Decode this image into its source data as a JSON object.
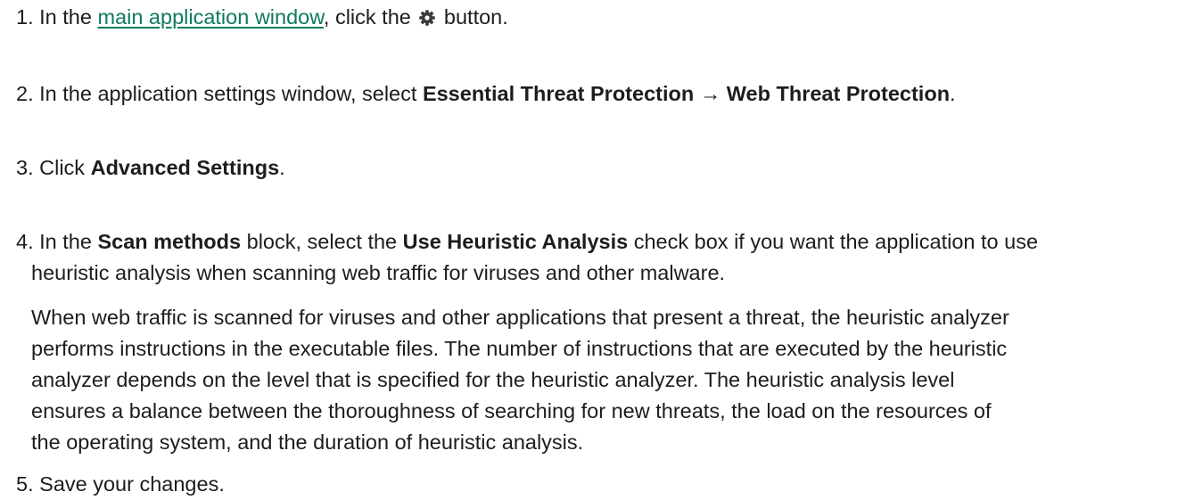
{
  "steps": [
    {
      "number": "1.",
      "pre": "In the ",
      "link": "main application window",
      "mid": ", click the ",
      "icon": "gear-icon",
      "post": " button."
    },
    {
      "number": "2.",
      "pre": "In the application settings window, select ",
      "bold1": "Essential Threat Protection",
      "arrow": " → ",
      "bold2": "Web Threat Protection",
      "post": "."
    },
    {
      "number": "3.",
      "pre": "Click ",
      "bold1": "Advanced Settings",
      "post": "."
    },
    {
      "number": "4.",
      "pre": "In the ",
      "bold1": "Scan methods",
      "mid": " block, select the ",
      "bold2": "Use Heuristic Analysis",
      "post_line1": " check box if you want the application to use",
      "post_line2": "heuristic analysis when scanning web traffic for viruses and other malware.",
      "note_lines": [
        "When web traffic is scanned for viruses and other applications that present a threat, the heuristic analyzer",
        "performs instructions in the executable files. The number of instructions that are executed by the heuristic",
        "analyzer depends on the level that is specified for the heuristic analyzer. The heuristic analysis level",
        "ensures a balance between the thoroughness of searching for new threats, the load on the resources of",
        "the operating system, and the duration of heuristic analysis."
      ]
    },
    {
      "number": "5.",
      "pre": "Save your changes."
    }
  ],
  "colors": {
    "text": "#1d1d1b",
    "link": "#0f7a5f",
    "icon": "#3a3a3a"
  }
}
